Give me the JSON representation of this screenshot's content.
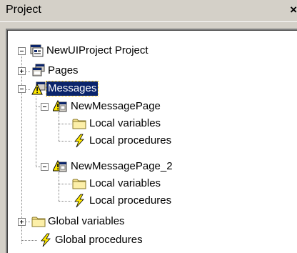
{
  "window": {
    "title": "Project",
    "close_glyph": "×"
  },
  "tree": {
    "root": {
      "label": "NewUIProject Project",
      "icon": "project-icon",
      "expanded": true
    },
    "pages": {
      "label": "Pages",
      "icon": "pages-icon",
      "expanded": false
    },
    "messages": {
      "label": "Messages",
      "icon": "messages-warning-icon",
      "expanded": true,
      "selected": true,
      "children": [
        {
          "label": "NewMessagePage",
          "icon": "message-page-icon",
          "expanded": true,
          "children": [
            {
              "label": "Local variables",
              "icon": "folder-icon"
            },
            {
              "label": "Local procedures",
              "icon": "lightning-icon"
            }
          ]
        },
        {
          "label": "NewMessagePage_2",
          "icon": "message-page-icon",
          "expanded": true,
          "children": [
            {
              "label": "Local variables",
              "icon": "folder-icon"
            },
            {
              "label": "Local procedures",
              "icon": "lightning-icon"
            }
          ]
        }
      ]
    },
    "global_variables": {
      "label": "Global variables",
      "icon": "folder-icon",
      "expanded": false
    },
    "global_procedures": {
      "label": "Global procedures",
      "icon": "lightning-icon"
    }
  },
  "colors": {
    "selection": "#0a246a",
    "window_bg": "#d4d0c8",
    "folder": "#f5e08a",
    "lightning": "#ffe800"
  }
}
